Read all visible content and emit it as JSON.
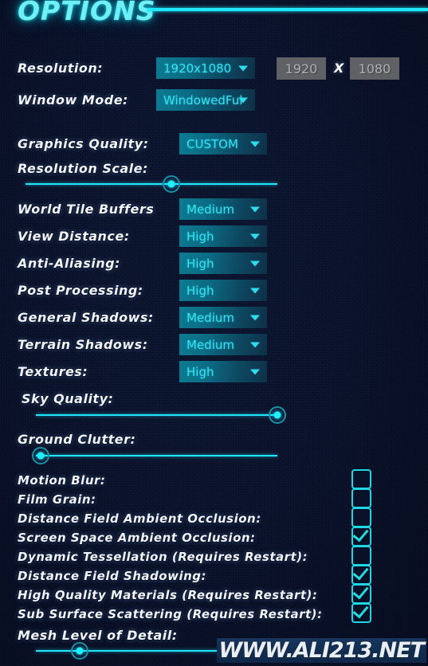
{
  "window": {
    "title": "OPTIONS",
    "watermark": "WWW.ALI213.NET"
  },
  "colors": {
    "background": "#0a0f2a",
    "accent_cyan": "#20e8fb",
    "dropdown_text": "#35e4f2",
    "label_white": "#f2f6f9",
    "title_cyan": "#6ef0f5",
    "checkbox_border": "#1ed6e4",
    "disabled_box": "#5f6164"
  },
  "display_settings": [
    {
      "label": "Resolution:",
      "control": "dropdown",
      "value": "1920x1080"
    },
    {
      "label": "Window Mode:",
      "control": "dropdown",
      "value": "WindowedFul"
    }
  ],
  "resolution_fields": {
    "width_value": "1920",
    "height_value": "1080",
    "separator": "X"
  },
  "graphics_quality": {
    "label": "Graphics Quality:",
    "value": "CUSTOM"
  },
  "sliders": [
    {
      "label": "Resolution Scale:",
      "percent": 58
    },
    {
      "label": "Sky Quality:",
      "percent": 100
    },
    {
      "label": "Ground Clutter:",
      "percent": 2
    },
    {
      "label": "Mesh Level of Detail:",
      "percent": 18
    }
  ],
  "dropdown_settings": [
    {
      "label": "World Tile Buffers",
      "value": "Medium"
    },
    {
      "label": "View Distance:",
      "value": "High"
    },
    {
      "label": "Anti-Aliasing:",
      "value": "High"
    },
    {
      "label": "Post Processing:",
      "value": "High"
    },
    {
      "label": "General Shadows:",
      "value": "Medium"
    },
    {
      "label": "Terrain Shadows:",
      "value": "Medium"
    },
    {
      "label": "Textures:",
      "value": "High"
    }
  ],
  "checkbox_settings": [
    {
      "label": "Motion Blur:",
      "checked": false
    },
    {
      "label": "Film Grain:",
      "checked": false
    },
    {
      "label": "Distance Field Ambient Occlusion:",
      "checked": false
    },
    {
      "label": "Screen Space Ambient Occlusion:",
      "checked": true
    },
    {
      "label": "Dynamic Tessellation (Requires Restart):",
      "checked": false
    },
    {
      "label": "Distance Field Shadowing:",
      "checked": true
    },
    {
      "label": "High Quality Materials (Requires Restart):",
      "checked": true
    },
    {
      "label": "Sub Surface Scattering (Requires Restart):",
      "checked": true
    }
  ]
}
